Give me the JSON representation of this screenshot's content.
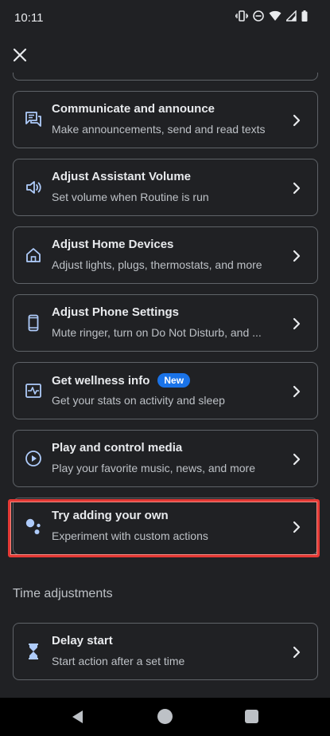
{
  "status_bar": {
    "time": "10:11",
    "icons": [
      "vibrate-icon",
      "do-not-disturb-icon",
      "wifi-icon",
      "signal-icon",
      "battery-icon"
    ]
  },
  "header": {
    "close_icon": "close-icon"
  },
  "actions": [
    {
      "title": "Communicate and announce",
      "subtitle": "Make announcements, send and read texts",
      "icon": "chat-icon"
    },
    {
      "title": "Adjust Assistant Volume",
      "subtitle": "Set volume when Routine is run",
      "icon": "volume-icon"
    },
    {
      "title": "Adjust Home Devices",
      "subtitle": "Adjust lights, plugs, thermostats, and more",
      "icon": "home-icon"
    },
    {
      "title": "Adjust Phone Settings",
      "subtitle": "Mute ringer, turn on Do Not Disturb, and ...",
      "icon": "phone-icon"
    },
    {
      "title": "Get wellness info",
      "badge": "New",
      "subtitle": "Get your stats on activity and sleep",
      "icon": "wellness-icon"
    },
    {
      "title": "Play and control media",
      "subtitle": "Play your favorite music, news, and more",
      "icon": "play-icon"
    },
    {
      "title": "Try adding your own",
      "subtitle": "Experiment with custom actions",
      "icon": "assistant-icon"
    }
  ],
  "time_adjustments": {
    "heading": "Time adjustments",
    "items": [
      {
        "title": "Delay start",
        "subtitle": "Start action after a set time",
        "icon": "hourglass-icon"
      }
    ]
  },
  "colors": {
    "background": "#202124",
    "card_border": "#5f6368",
    "icon_blue": "#aecbfa",
    "badge": "#1a73e8",
    "highlight": "#e53935"
  }
}
